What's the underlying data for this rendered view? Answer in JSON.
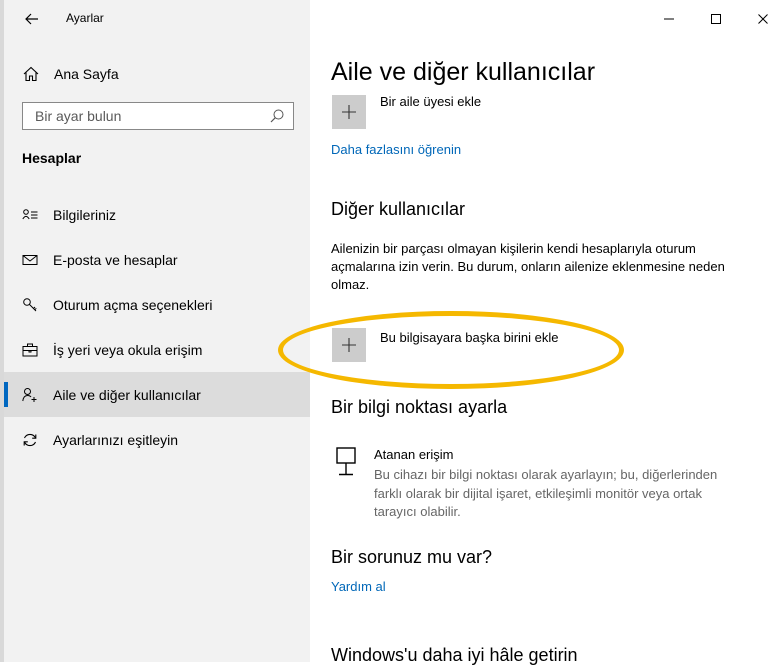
{
  "window": {
    "title": "Ayarlar"
  },
  "sidebar": {
    "home_label": "Ana Sayfa",
    "search_placeholder": "Bir ayar bulun",
    "section_title": "Hesaplar",
    "items": [
      {
        "label": "Bilgileriniz",
        "icon": "person-card-icon"
      },
      {
        "label": "E-posta ve hesaplar",
        "icon": "mail-icon"
      },
      {
        "label": "Oturum açma seçenekleri",
        "icon": "key-icon"
      },
      {
        "label": "İş yeri veya okula erişim",
        "icon": "briefcase-icon"
      },
      {
        "label": "Aile ve diğer kullanıcılar",
        "icon": "add-person-icon",
        "selected": true
      },
      {
        "label": "Ayarlarınızı eşitleyin",
        "icon": "sync-icon"
      }
    ]
  },
  "main": {
    "title": "Aile ve diğer kullanıcılar",
    "add_family_label": "Bir aile üyesi ekle",
    "learn_more_link": "Daha fazlasını öğrenin",
    "other_users": {
      "heading": "Diğer kullanıcılar",
      "description": "Ailenizin bir parçası olmayan kişilerin kendi hesaplarıyla oturum açmalarına izin verin. Bu durum, onların ailenize eklenmesine neden olmaz.",
      "add_other_label": "Bu bilgisayara başka birini ekle"
    },
    "kiosk": {
      "heading": "Bir bilgi noktası ayarla",
      "item_title": "Atanan erişim",
      "item_description": "Bu cihazı bir bilgi noktası olarak ayarlayın; bu, diğerlerinden farklı olarak bir dijital işaret, etkileşimli monitör veya ortak tarayıcı olabilir."
    },
    "help": {
      "heading": "Bir sorunuz mu var?",
      "link": "Yardım al"
    },
    "feedback": {
      "heading": "Windows'u daha iyi hâle getirin"
    }
  },
  "colors": {
    "accent": "#0067b8",
    "highlight_ellipse": "#f5b800"
  }
}
